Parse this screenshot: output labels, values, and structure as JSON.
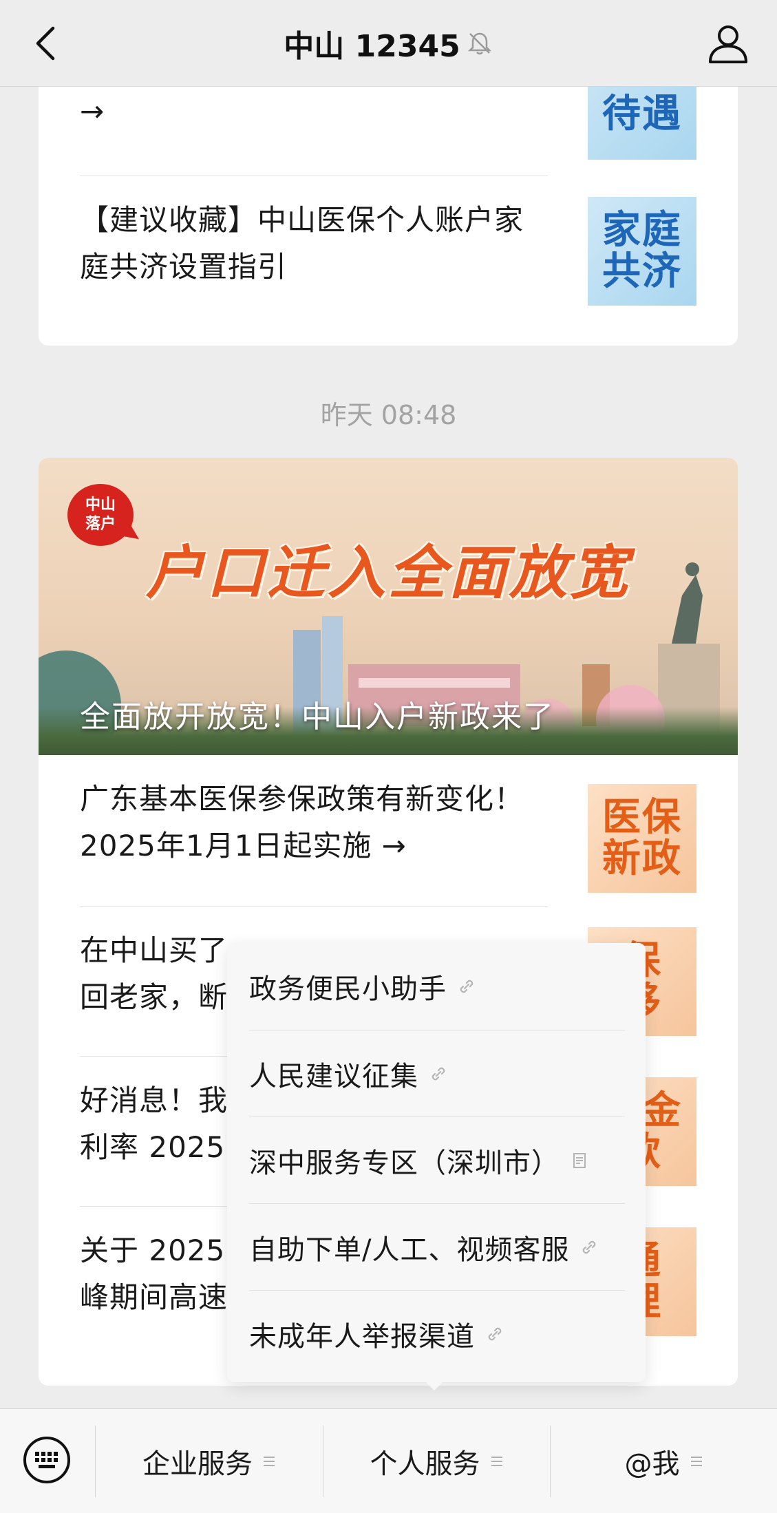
{
  "header": {
    "title": "中山 12345"
  },
  "top_card": {
    "items": [
      {
        "title_line1": "",
        "title_line2": "→",
        "thumb": [
          "",
          "待遇"
        ]
      },
      {
        "title_line1": "【建议收藏】中山医保个人账户家",
        "title_line2": "庭共济设置指引",
        "thumb": [
          "家庭",
          "共济"
        ]
      }
    ]
  },
  "timestamp": "昨天 08:48",
  "main_card": {
    "banner": {
      "badge": [
        "中山",
        "落户"
      ],
      "headline": "户口迁入全面放宽",
      "caption": "全面放开放宽！中山入户新政来了"
    },
    "items": [
      {
        "title_line1": "广东基本医保参保政策有新变化！",
        "title_line2": "2025年1月1日起实施 →",
        "thumb": [
          "医保",
          "新政"
        ]
      },
      {
        "title_line1": "在中山买了",
        "title_line2": "回老家，断",
        "thumb": [
          "保",
          "移"
        ]
      },
      {
        "title_line1": "好消息！我",
        "title_line2": "利率 2025",
        "thumb": [
          "积金",
          "款"
        ]
      },
      {
        "title_line1": "关于 2025",
        "title_line2": "峰期间高速",
        "thumb": [
          "通",
          "理"
        ]
      }
    ]
  },
  "popup_menu": {
    "items": [
      {
        "label": "政务便民小助手",
        "icon": "link-icon"
      },
      {
        "label": "人民建议征集",
        "icon": "link-icon"
      },
      {
        "label": "深中服务专区（深圳市）",
        "icon": "page-icon"
      },
      {
        "label": "自助下单/人工、视频客服",
        "icon": "link-icon"
      },
      {
        "label": "未成年人举报渠道",
        "icon": "link-icon"
      }
    ]
  },
  "bottom_menu": {
    "items": [
      {
        "label": "企业服务"
      },
      {
        "label": "个人服务"
      },
      {
        "label": "@我"
      }
    ]
  },
  "colors": {
    "accent_blue": "#1d66b8",
    "accent_orange": "#e35f17",
    "banner_red": "#d7231d"
  }
}
